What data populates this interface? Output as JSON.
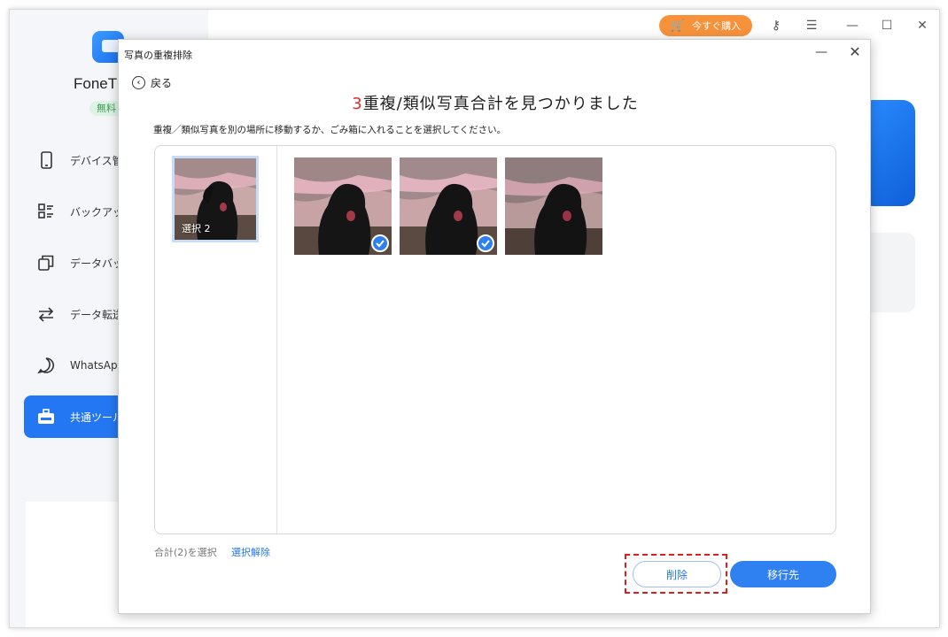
{
  "app": {
    "name": "FoneT",
    "license_badge": "無料",
    "buy_button": "今すぐ購入"
  },
  "sidebar": {
    "items": [
      {
        "label": "デバイス管",
        "icon": "phone-icon"
      },
      {
        "label": "バックアッ",
        "icon": "list-icon"
      },
      {
        "label": "データバッ",
        "icon": "copy-icon"
      },
      {
        "label": "データ転送",
        "icon": "transfer-icon"
      },
      {
        "label": "WhatsApp",
        "icon": "chat-icon"
      },
      {
        "label": "共通ツール",
        "icon": "toolbox-icon",
        "active": true
      }
    ]
  },
  "dialog": {
    "title": "写真の重複排除",
    "back_label": "戻る",
    "heading_count": "3",
    "heading_text": "重複/類似写真合計を見つかりました",
    "instruction": "重複／類似写真を別の場所に移動するか、ごみ箱に入れることを選択してください。",
    "group_label": "選択 2",
    "photos": [
      {
        "checked": true
      },
      {
        "checked": true
      },
      {
        "checked": false
      }
    ],
    "selection_count": "合計(2)を選択",
    "deselect_label": "選択解除",
    "delete_label": "削除",
    "move_label": "移行先"
  },
  "colors": {
    "accent": "#2477f2",
    "highlight": "#e31b1b",
    "buy": "#f7923b",
    "count": "#e52a2a"
  }
}
